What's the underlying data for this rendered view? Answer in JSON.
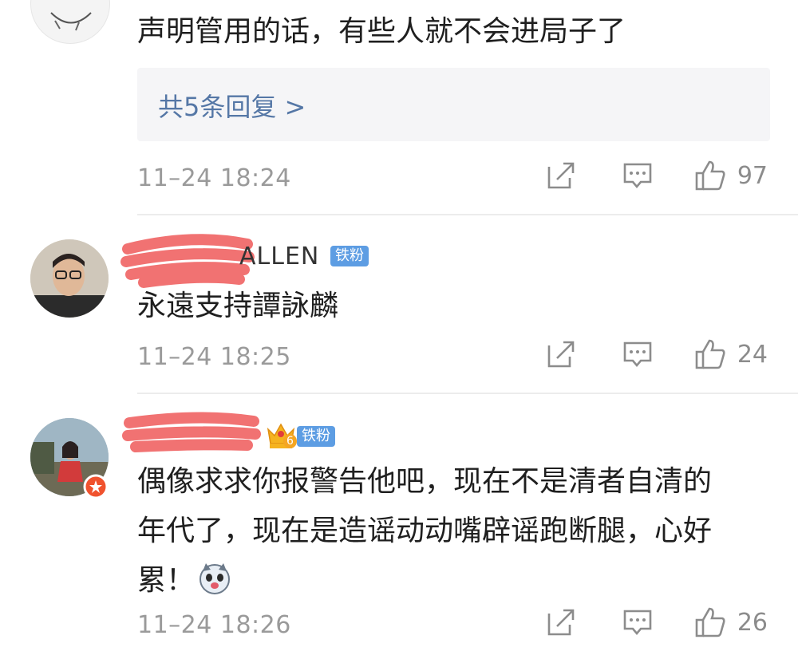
{
  "comments": [
    {
      "text": "声明管用的话，有些人就不会进局子了",
      "replies_link": "共5条回复 >",
      "time": "11–24 18:24",
      "likes": "97"
    },
    {
      "username": "ALLEN",
      "badge": "铁粉",
      "text": "永遠支持譚詠麟",
      "time": "11–24 18:25",
      "likes": "24"
    },
    {
      "badge": "铁粉",
      "crown_level": "6",
      "lines": [
        "偶像求求你报警告他吧，现在不是清者自清的",
        "年代了，现在是造谣动动嘴辟谣跑断腿，心好",
        "累！"
      ],
      "time": "11–24 18:26",
      "likes": "26"
    }
  ],
  "colors": {
    "link": "#5577a6",
    "badge": "#5d9de3",
    "timestamp": "#9a9a9a",
    "redaction": "#f06a6a"
  },
  "icons": [
    "share-icon",
    "comment-icon",
    "thumbs-up-icon",
    "dog-emoji-icon",
    "crown-icon"
  ]
}
